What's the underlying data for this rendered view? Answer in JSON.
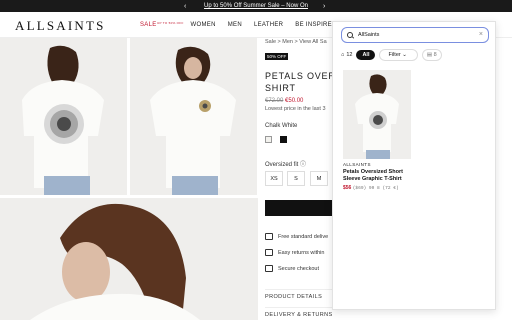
{
  "promo": {
    "text": "Up to 50% Off Summer Sale – Now On",
    "prev": "‹",
    "next": "›"
  },
  "header": {
    "logo": "ALLSAINTS",
    "nav": {
      "sale": "SALE",
      "sale_badge": "UP TO 50% OFF",
      "women": "WOMEN",
      "men": "MEN",
      "leather": "LEATHER",
      "be_inspired": "BE INSPIRED"
    }
  },
  "product": {
    "breadcrumb": "Sale  >  Men  >  View All Sa",
    "badge": "50% OFF",
    "title": "PETALS OVERS SHIRT",
    "price_old": "€72.00",
    "price_new": "€50.00",
    "lowest_price": "Lowest price in the last 3",
    "color_label": "Chalk White",
    "fit_label": "Oversized fit",
    "sizes": [
      "XS",
      "S",
      "M"
    ],
    "features": [
      "Free standard delive",
      "Easy returns within",
      "Secure checkout"
    ],
    "accordions": [
      "PRODUCT DETAILS",
      "DELIVERY & RETURNS"
    ]
  },
  "panel": {
    "search_value": "AllSaints",
    "result_count": "12",
    "filter_all": "All",
    "filter_label": "Filter",
    "filter_extra": "8",
    "card": {
      "brand": "ALLSAINTS",
      "title": "Petals Oversized Short Sleeve Graphic T-Shirt",
      "price": "$56",
      "price_extra": "($69)  90 8 (72 €)"
    }
  },
  "colors": {
    "sale_red": "#c0152d",
    "black": "#111111",
    "accent_blue": "#7a8fe0"
  }
}
